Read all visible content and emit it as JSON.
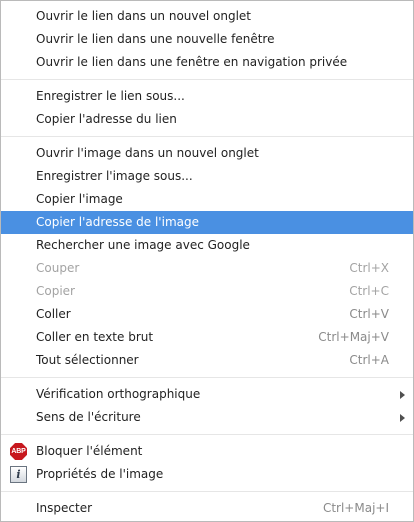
{
  "menu": {
    "group_link": [
      {
        "label": "Ouvrir le lien dans un nouvel onglet"
      },
      {
        "label": "Ouvrir le lien dans une nouvelle fenêtre"
      },
      {
        "label": "Ouvrir le lien dans une fenêtre en navigation privée"
      }
    ],
    "group_save_link": [
      {
        "label": "Enregistrer le lien sous..."
      },
      {
        "label": "Copier l'adresse du lien"
      }
    ],
    "group_image": [
      {
        "label": "Ouvrir l'image dans un nouvel onglet"
      },
      {
        "label": "Enregistrer l'image sous..."
      },
      {
        "label": "Copier l'image"
      },
      {
        "label": "Copier l'adresse de l'image",
        "state": "highlighted"
      },
      {
        "label": "Rechercher une image avec Google"
      }
    ],
    "group_edit": [
      {
        "label": "Couper",
        "shortcut": "Ctrl+X",
        "state": "disabled"
      },
      {
        "label": "Copier",
        "shortcut": "Ctrl+C",
        "state": "disabled"
      },
      {
        "label": "Coller",
        "shortcut": "Ctrl+V"
      },
      {
        "label": "Coller en texte brut",
        "shortcut": "Ctrl+Maj+V"
      },
      {
        "label": "Tout sélectionner",
        "shortcut": "Ctrl+A"
      }
    ],
    "group_text": [
      {
        "label": "Vérification orthographique",
        "submenu": true
      },
      {
        "label": "Sens de l'écriture",
        "submenu": true
      }
    ],
    "group_extensions": [
      {
        "label": "Bloquer l'élément",
        "icon": "adblock-plus-icon",
        "icon_text": "ABP",
        "icon_color": "#c7181e"
      },
      {
        "label": "Propriétés de l'image",
        "icon": "info-icon",
        "icon_text": "i"
      }
    ],
    "group_inspect": [
      {
        "label": "Inspecter",
        "shortcut": "Ctrl+Maj+I"
      }
    ]
  },
  "colors": {
    "highlight": "#4a90e2",
    "text": "#222222",
    "disabled_text": "#a3a3a3",
    "separator": "#e6e6e6"
  }
}
